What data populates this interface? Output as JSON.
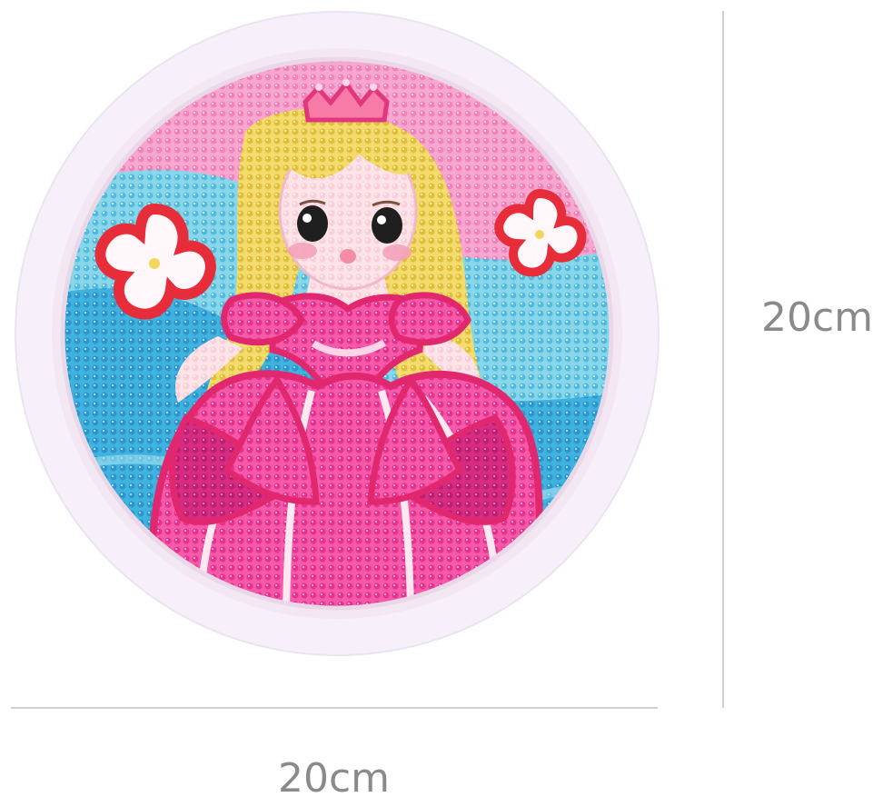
{
  "product": {
    "subject": "princess-diamond-painting",
    "frame_color": "#f7f0fa",
    "accent_colors": {
      "dress": "#f23e9d",
      "dress_shadow": "#cf2f84",
      "hair": "#e5c440",
      "sky": "#f39bc8",
      "water": "#79c7e2",
      "flower_outline": "#e72d39"
    }
  },
  "dimensions": {
    "width_label": "20cm",
    "height_label": "20cm",
    "line_color": "#d0d0d0",
    "text_color": "#8a8a8a"
  }
}
